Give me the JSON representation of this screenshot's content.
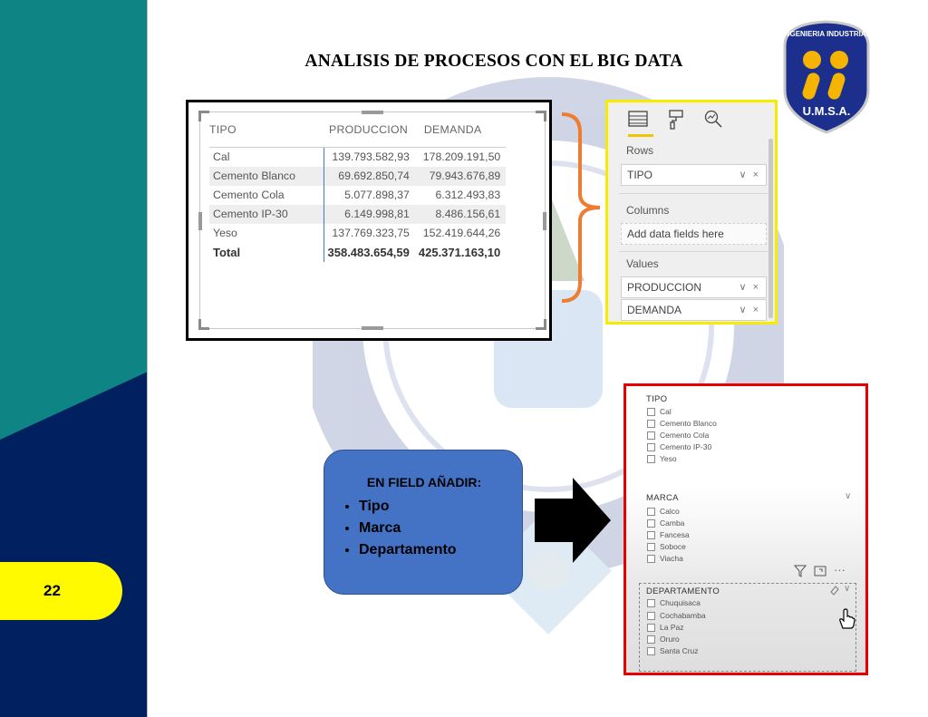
{
  "slide": {
    "title": "ANALISIS DE PROCESOS CON EL BIG DATA",
    "page_number": "22",
    "colors": {
      "teal": "#0e8484",
      "navy": "#002060",
      "yellow": "#fffa00"
    }
  },
  "logo": {
    "ring_text": "INGENIERIA INDUSTRIAL",
    "caption": "U.M.S.A."
  },
  "table": {
    "headers": [
      "TIPO",
      "PRODUCCION",
      "DEMANDA"
    ],
    "rows": [
      {
        "tipo": "Cal",
        "produccion": "139.793.582,93",
        "demanda": "178.209.191,50"
      },
      {
        "tipo": "Cemento Blanco",
        "produccion": "69.692.850,74",
        "demanda": "79.943.676,89"
      },
      {
        "tipo": "Cemento Cola",
        "produccion": "5.077.898,37",
        "demanda": "6.312.493,83"
      },
      {
        "tipo": "Cemento IP-30",
        "produccion": "6.149.998,81",
        "demanda": "8.486.156,61"
      },
      {
        "tipo": "Yeso",
        "produccion": "137.769.323,75",
        "demanda": "152.419.644,26"
      }
    ],
    "total": {
      "label": "Total",
      "produccion": "358.483.654,59",
      "demanda": "425.371.163,10"
    }
  },
  "fields_pane": {
    "icons": [
      "table-icon",
      "paint-roller-icon",
      "analytics-magnifier-icon"
    ],
    "rows_label": "Rows",
    "rows_field": "TIPO",
    "columns_label": "Columns",
    "columns_placeholder": "Add data fields here",
    "values_label": "Values",
    "values_fields": [
      "PRODUCCION",
      "DEMANDA"
    ],
    "field_controls": "∨ ×"
  },
  "callout": {
    "title": "EN FIELD AÑADIR:",
    "items": [
      "Tipo",
      "Marca",
      "Departamento"
    ]
  },
  "slicers": {
    "tipo": {
      "title": "TIPO",
      "items": [
        "Cal",
        "Cemento Blanco",
        "Cemento Cola",
        "Cemento IP-30",
        "Yeso"
      ]
    },
    "marca": {
      "title": "MARCA",
      "items": [
        "Calco",
        "Camba",
        "Fancesa",
        "Soboce",
        "Viacha"
      ]
    },
    "departamento": {
      "title": "DEPARTAMENTO",
      "items": [
        "Chuquisaca",
        "Cochabamba",
        "La Paz",
        "Oruro",
        "Santa Cruz"
      ]
    },
    "toolbar": {
      "more": "···"
    }
  }
}
